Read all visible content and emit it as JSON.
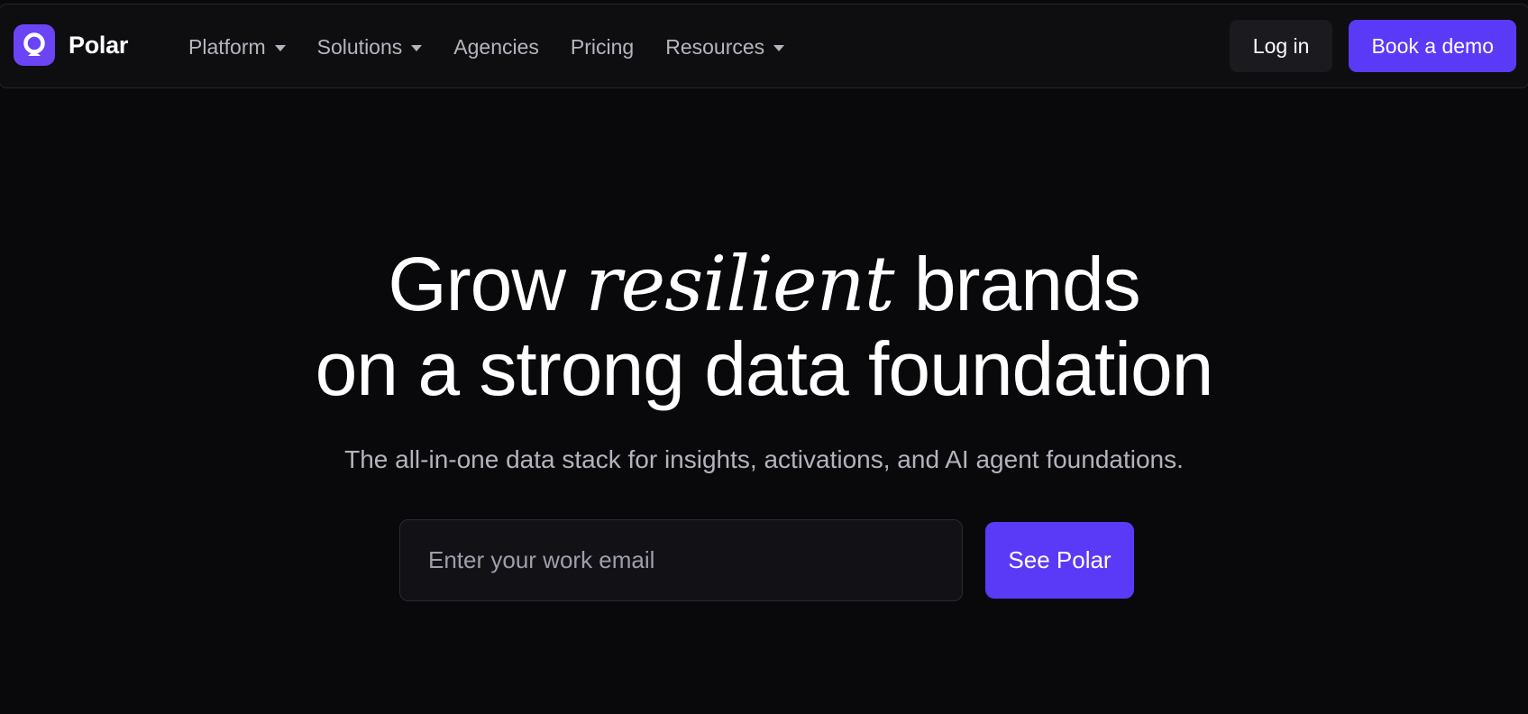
{
  "brand": {
    "name": "Polar",
    "logo_icon": "polar-logo-icon",
    "accent_color": "#5a3af6"
  },
  "nav": {
    "items": [
      {
        "label": "Platform",
        "has_dropdown": true
      },
      {
        "label": "Solutions",
        "has_dropdown": true
      },
      {
        "label": "Agencies",
        "has_dropdown": false
      },
      {
        "label": "Pricing",
        "has_dropdown": false
      },
      {
        "label": "Resources",
        "has_dropdown": true
      }
    ],
    "login_label": "Log in",
    "demo_label": "Book a demo"
  },
  "hero": {
    "title_before": "Grow",
    "title_accent": "resilient",
    "title_after": "brands",
    "title_line2": "on a strong data foundation",
    "subtitle": "The all-in-one data stack for insights, activations, and AI agent foundations.",
    "email_placeholder": "Enter your work email",
    "cta_label": "See Polar"
  },
  "colors": {
    "background": "#09090b",
    "nav_background": "#0e0e11",
    "primary": "#5a3af6",
    "muted_text": "#b3b3bd"
  }
}
